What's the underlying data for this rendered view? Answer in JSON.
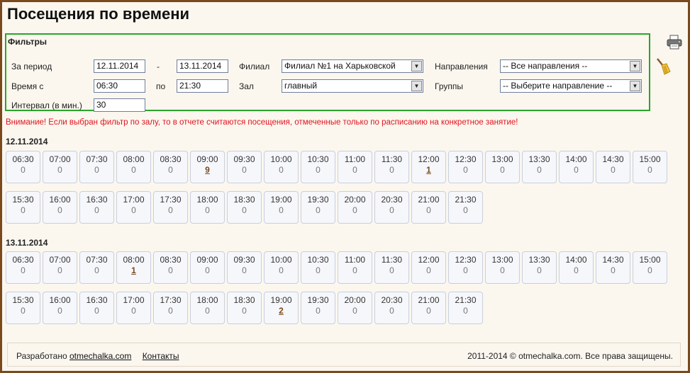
{
  "page": {
    "title": "Посещения по времени"
  },
  "filters": {
    "title": "Фильтры",
    "period_label": "За период",
    "date_from": "12.11.2014",
    "dash": "-",
    "date_to": "13.11.2014",
    "time_label": "Время с",
    "time_from": "06:30",
    "po": "по",
    "time_to": "21:30",
    "interval_label": "Интервал (в мин.)",
    "interval": "30",
    "branch_label": "Филиал",
    "branch_value": "Филиал №1 на Харьковской",
    "hall_label": "Зал",
    "hall_value": "главный",
    "direction_label": "Направления",
    "direction_value": "-- Все направления --",
    "groups_label": "Группы",
    "groups_value": "-- Выберите направление --"
  },
  "warning": "Внимание! Если выбран фильтр по залу, то в отчете считаются посещения, отмеченные только по расписанию на конкретное занятие!",
  "days": [
    {
      "date": "12.11.2014",
      "slots": [
        {
          "time": "06:30",
          "count": "0"
        },
        {
          "time": "07:00",
          "count": "0"
        },
        {
          "time": "07:30",
          "count": "0"
        },
        {
          "time": "08:00",
          "count": "0"
        },
        {
          "time": "08:30",
          "count": "0"
        },
        {
          "time": "09:00",
          "count": "9"
        },
        {
          "time": "09:30",
          "count": "0"
        },
        {
          "time": "10:00",
          "count": "0"
        },
        {
          "time": "10:30",
          "count": "0"
        },
        {
          "time": "11:00",
          "count": "0"
        },
        {
          "time": "11:30",
          "count": "0"
        },
        {
          "time": "12:00",
          "count": "1"
        },
        {
          "time": "12:30",
          "count": "0"
        },
        {
          "time": "13:00",
          "count": "0"
        },
        {
          "time": "13:30",
          "count": "0"
        },
        {
          "time": "14:00",
          "count": "0"
        },
        {
          "time": "14:30",
          "count": "0"
        },
        {
          "time": "15:00",
          "count": "0"
        },
        {
          "time": "15:30",
          "count": "0"
        },
        {
          "time": "16:00",
          "count": "0"
        },
        {
          "time": "16:30",
          "count": "0"
        },
        {
          "time": "17:00",
          "count": "0"
        },
        {
          "time": "17:30",
          "count": "0"
        },
        {
          "time": "18:00",
          "count": "0"
        },
        {
          "time": "18:30",
          "count": "0"
        },
        {
          "time": "19:00",
          "count": "0"
        },
        {
          "time": "19:30",
          "count": "0"
        },
        {
          "time": "20:00",
          "count": "0"
        },
        {
          "time": "20:30",
          "count": "0"
        },
        {
          "time": "21:00",
          "count": "0"
        },
        {
          "time": "21:30",
          "count": "0"
        }
      ]
    },
    {
      "date": "13.11.2014",
      "slots": [
        {
          "time": "06:30",
          "count": "0"
        },
        {
          "time": "07:00",
          "count": "0"
        },
        {
          "time": "07:30",
          "count": "0"
        },
        {
          "time": "08:00",
          "count": "1"
        },
        {
          "time": "08:30",
          "count": "0"
        },
        {
          "time": "09:00",
          "count": "0"
        },
        {
          "time": "09:30",
          "count": "0"
        },
        {
          "time": "10:00",
          "count": "0"
        },
        {
          "time": "10:30",
          "count": "0"
        },
        {
          "time": "11:00",
          "count": "0"
        },
        {
          "time": "11:30",
          "count": "0"
        },
        {
          "time": "12:00",
          "count": "0"
        },
        {
          "time": "12:30",
          "count": "0"
        },
        {
          "time": "13:00",
          "count": "0"
        },
        {
          "time": "13:30",
          "count": "0"
        },
        {
          "time": "14:00",
          "count": "0"
        },
        {
          "time": "14:30",
          "count": "0"
        },
        {
          "time": "15:00",
          "count": "0"
        },
        {
          "time": "15:30",
          "count": "0"
        },
        {
          "time": "16:00",
          "count": "0"
        },
        {
          "time": "16:30",
          "count": "0"
        },
        {
          "time": "17:00",
          "count": "0"
        },
        {
          "time": "17:30",
          "count": "0"
        },
        {
          "time": "18:00",
          "count": "0"
        },
        {
          "time": "18:30",
          "count": "0"
        },
        {
          "time": "19:00",
          "count": "2"
        },
        {
          "time": "19:30",
          "count": "0"
        },
        {
          "time": "20:00",
          "count": "0"
        },
        {
          "time": "20:30",
          "count": "0"
        },
        {
          "time": "21:00",
          "count": "0"
        },
        {
          "time": "21:30",
          "count": "0"
        }
      ]
    }
  ],
  "footer": {
    "developed_by": "Разработано",
    "site_link": "otmechalka.com",
    "contacts": "Контакты",
    "copyright": "2011-2014 © otmechalka.com. Все права защищены."
  },
  "icons": {
    "print": "printer-icon",
    "clear": "broom-icon"
  },
  "colors": {
    "warning": "#e0141e",
    "filter_border": "#2aa52a",
    "frame": "#7a4a1c",
    "link": "#7a4a1c"
  }
}
